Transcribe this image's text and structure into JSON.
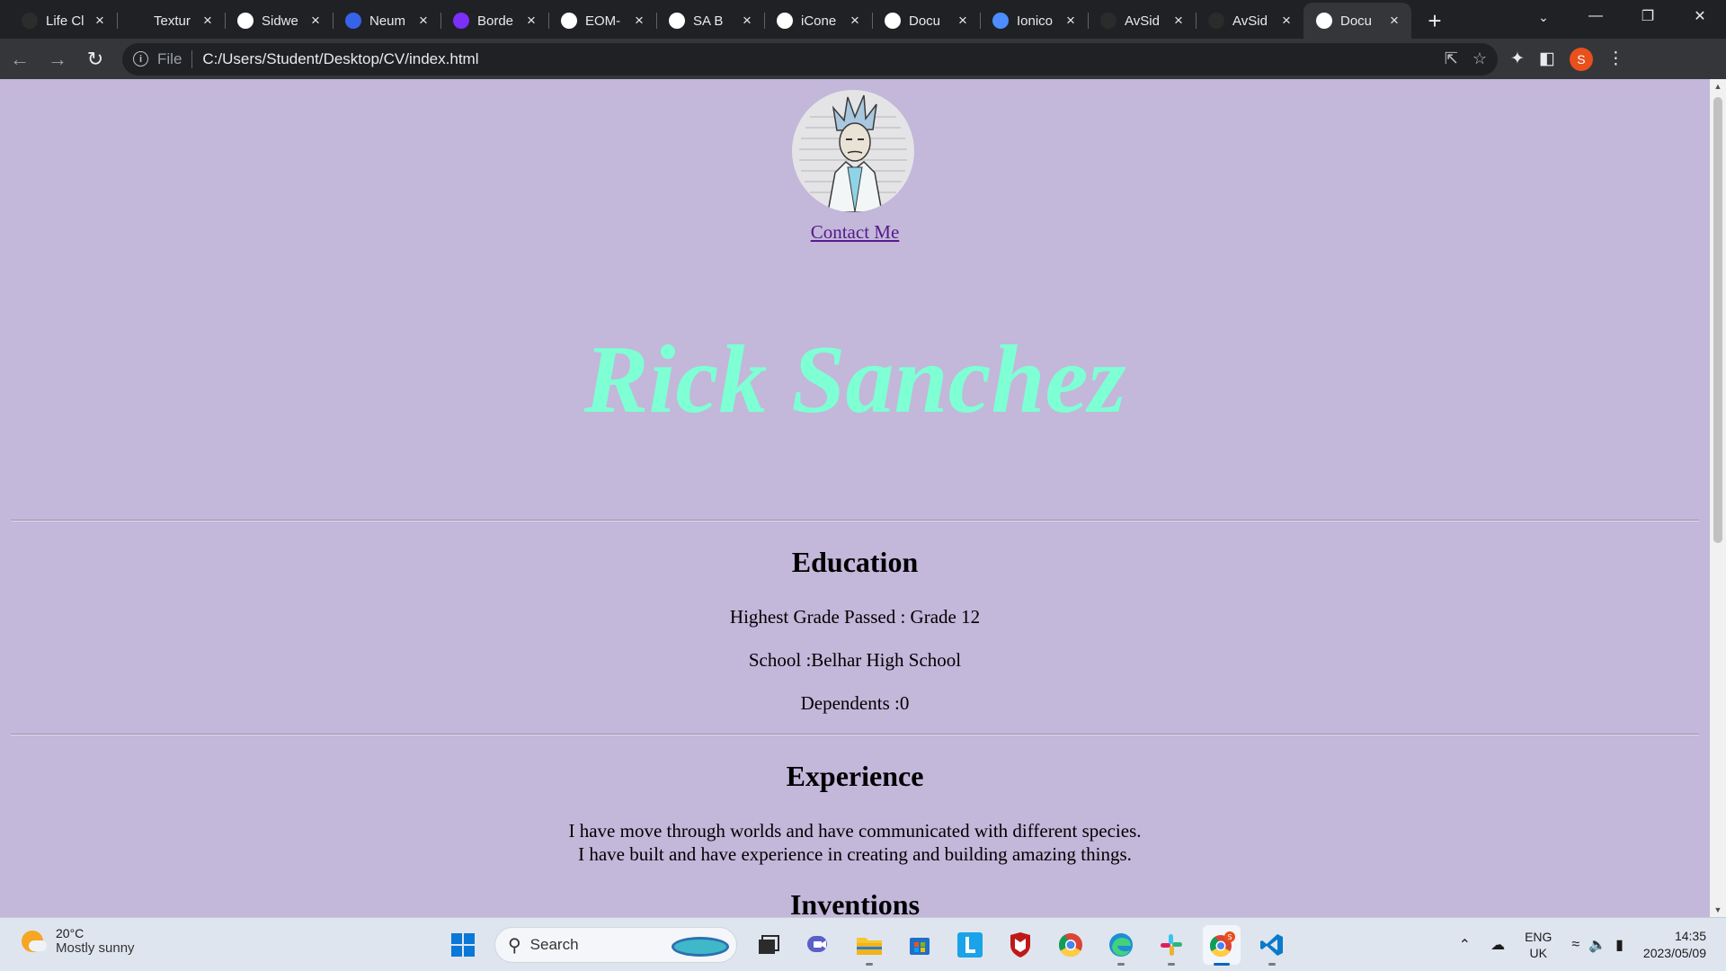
{
  "browser": {
    "tabs": [
      {
        "title": "Life Cl",
        "favicon": "life-favicon",
        "color": "#2c2c2c"
      },
      {
        "title": "Textur",
        "favicon": "blank-favicon",
        "color": "#202124"
      },
      {
        "title": "Sidwe",
        "favicon": "clickup-favicon",
        "color": "#ffffff"
      },
      {
        "title": "Neum",
        "favicon": "neumorphism-favicon",
        "color": "#3563e9"
      },
      {
        "title": "Borde",
        "favicon": "bootstrap-favicon",
        "color": "#7b2ff7"
      },
      {
        "title": "EOM-",
        "favicon": "globe-favicon",
        "color": "#ffffff"
      },
      {
        "title": "SA B",
        "favicon": "globe-favicon",
        "color": "#ffffff"
      },
      {
        "title": "iCone",
        "favicon": "globe-favicon",
        "color": "#ffffff"
      },
      {
        "title": "Docu",
        "favicon": "globe-favicon",
        "color": "#ffffff"
      },
      {
        "title": "Ionico",
        "favicon": "ionicons-favicon",
        "color": "#4d8dff"
      },
      {
        "title": "AvSid",
        "favicon": "github-favicon",
        "color": "#2b2b2b"
      },
      {
        "title": "AvSid",
        "favicon": "github-favicon",
        "color": "#2b2b2b"
      },
      {
        "title": "Docu",
        "favicon": "globe-favicon",
        "color": "#ffffff",
        "active": true
      }
    ],
    "address": {
      "scheme_label": "File",
      "url": "C:/Users/Student/Desktop/CV/index.html"
    },
    "profile_initial": "S"
  },
  "page": {
    "contact_link": "Contact Me",
    "name": "Rick Sanchez",
    "name_color": "#7fffd4",
    "background": "#c3b7da",
    "education": {
      "heading": "Education",
      "lines": [
        "Highest Grade Passed : Grade 12",
        "School :Belhar High School",
        "Dependents :0"
      ]
    },
    "experience": {
      "heading": "Experience",
      "lines": [
        "I have move through worlds and have communicated with different species.",
        "I have built and have experience in creating and building amazing things."
      ]
    },
    "inventions": {
      "heading": "Inventions"
    }
  },
  "taskbar": {
    "weather": {
      "temp": "20°C",
      "desc": "Mostly sunny"
    },
    "search_placeholder": "Search",
    "apps": [
      "windows-start-icon",
      "file-explorer-icon",
      "teams-icon",
      "folder-icon",
      "microsoft-store-icon",
      "l-app-icon",
      "mcafee-icon",
      "chrome-icon",
      "edge-icon",
      "slack-icon",
      "chrome-profile-icon",
      "vscode-icon"
    ],
    "tray": {
      "lang_top": "ENG",
      "lang_bottom": "UK",
      "time": "14:35",
      "date": "2023/05/09"
    }
  }
}
